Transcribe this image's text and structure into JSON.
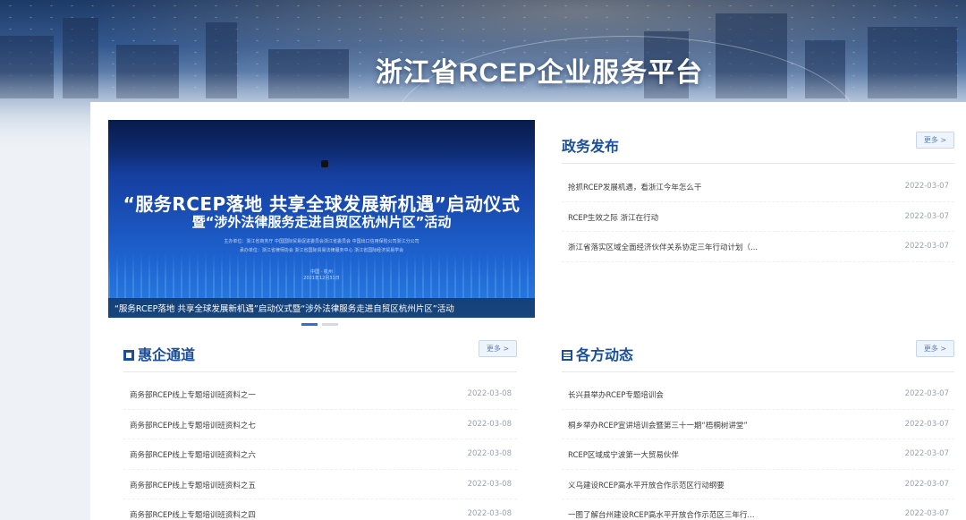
{
  "header": {
    "platform_title": "浙江省RCEP企业服务平台"
  },
  "carousel": {
    "headline": "“服务RCEP落地 共享全球发展新机遇”启动仪式",
    "subheadline": "暨“涉外法律服务走进自贸区杭州片区”活动",
    "fineprint_1": "主办单位：浙江省商务厅 中国国际贸易促进委员会浙江省委员会 中国出口信用保险公司浙江分公司",
    "fineprint_2": "承办单位：浙江省律师协会 浙江省国际贸易法律服务中心 浙江省国际经济贸易学会",
    "fineprint_3": "中国 · 杭州",
    "fineprint_4": "2021年12月31日",
    "caption": "“服务RCEP落地 共享全球发展新机遇”启动仪式暨“涉外法律服务走进自贸区杭州片区”活动",
    "slides": 2,
    "active_slide": 1
  },
  "sections": {
    "zhengwu": {
      "title": "政务发布",
      "more_label": "更多 >",
      "items": [
        {
          "title": "抢抓RCEP发展机遇，看浙江今年怎么干",
          "date": "2022-03-07"
        },
        {
          "title": "RCEP生效之际 浙江在行动",
          "date": "2022-03-07"
        },
        {
          "title": "浙江省落实区域全面经济伙伴关系协定三年行动计划（...",
          "date": "2022-03-07"
        }
      ]
    },
    "huiqi": {
      "title": "惠企通道",
      "more_label": "更多 >",
      "items": [
        {
          "title": "商务部RCEP线上专题培训班资料之一",
          "date": "2022-03-08"
        },
        {
          "title": "商务部RCEP线上专题培训班资料之七",
          "date": "2022-03-08"
        },
        {
          "title": "商务部RCEP线上专题培训班资料之六",
          "date": "2022-03-08"
        },
        {
          "title": "商务部RCEP线上专题培训班资料之五",
          "date": "2022-03-08"
        },
        {
          "title": "商务部RCEP线上专题培训班资料之四",
          "date": "2022-03-08"
        }
      ]
    },
    "gefang": {
      "title": "各方动态",
      "more_label": "更多 >",
      "items": [
        {
          "title": "长兴县举办RCEP专题培训会",
          "date": "2022-03-07"
        },
        {
          "title": "桐乡举办RCEP宣讲培训会暨第三十一期“梧桐树讲堂”",
          "date": "2022-03-07"
        },
        {
          "title": "RCEP区域成宁波第一大贸易伙伴",
          "date": "2022-03-07"
        },
        {
          "title": "义乌建设RCEP高水平开放合作示范区行动纲要",
          "date": "2022-03-07"
        },
        {
          "title": "一图了解台州建设RCEP高水平开放合作示范区三年行...",
          "date": "2022-03-07"
        }
      ]
    }
  },
  "colors": {
    "accent": "#1b4f9b",
    "more_bg": "#eef4fc",
    "date": "#9aa3ad"
  }
}
